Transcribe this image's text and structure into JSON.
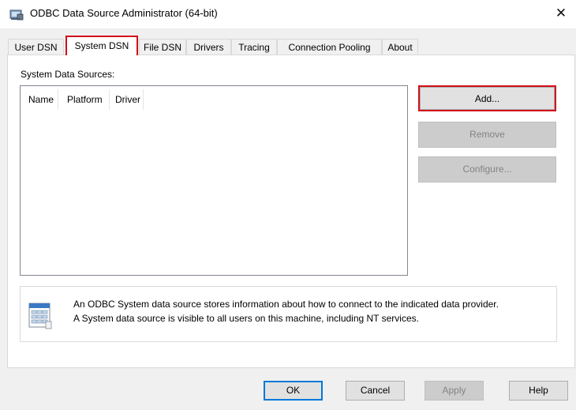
{
  "window": {
    "title": "ODBC Data Source Administrator (64-bit)",
    "close_label": "✕"
  },
  "tabs": [
    {
      "label": "User DSN",
      "active": false
    },
    {
      "label": "System DSN",
      "active": true
    },
    {
      "label": "File DSN",
      "active": false
    },
    {
      "label": "Drivers",
      "active": false
    },
    {
      "label": "Tracing",
      "active": false
    },
    {
      "label": "Connection Pooling",
      "active": false
    },
    {
      "label": "About",
      "active": false
    }
  ],
  "system_dsn": {
    "section_label": "System Data Sources:",
    "columns": [
      "Name",
      "Platform",
      "Driver"
    ],
    "rows": [],
    "buttons": {
      "add": "Add...",
      "remove": "Remove",
      "configure": "Configure..."
    },
    "info": {
      "icon": "data-source-info-icon",
      "line1": "An ODBC System data source stores information about how to connect to the indicated data provider.",
      "line2": "A System data source is visible to all users on this machine, including NT services."
    }
  },
  "footer": {
    "ok": "OK",
    "cancel": "Cancel",
    "apply": "Apply",
    "help": "Help"
  },
  "colors": {
    "highlight_border": "#d0101a",
    "default_button_border": "#0078d7",
    "disabled_text": "#838383"
  }
}
